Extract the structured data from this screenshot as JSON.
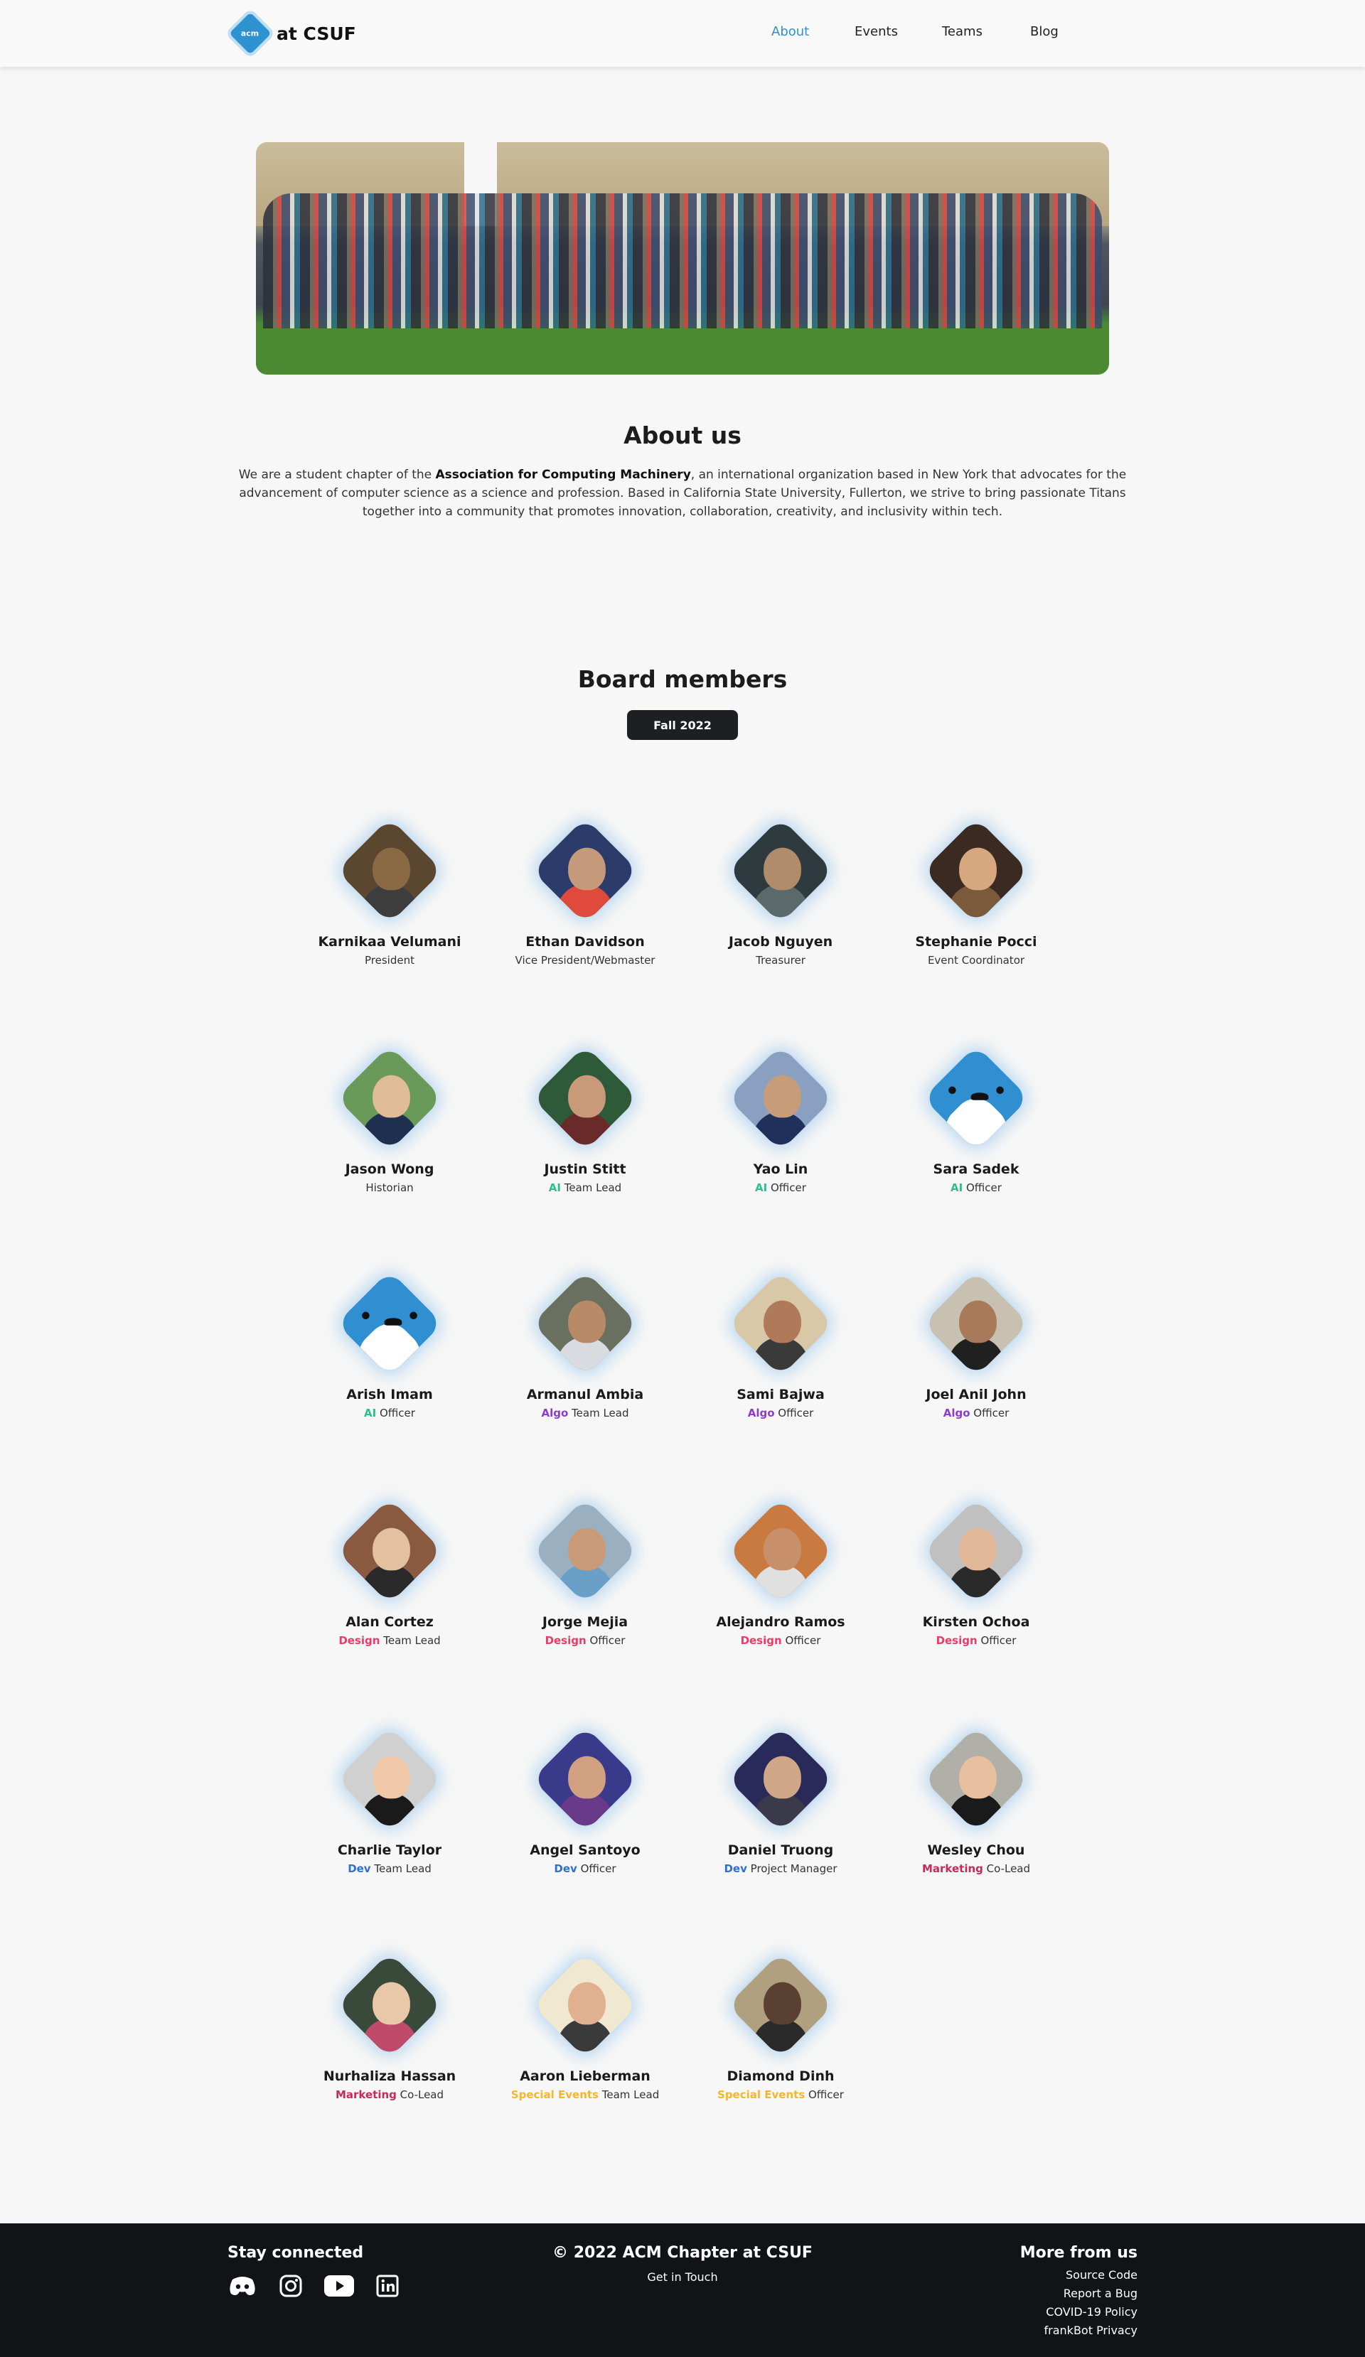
{
  "header": {
    "brand_logo_text": "acm",
    "brand_text": "at CSUF",
    "nav": [
      {
        "label": "About",
        "active": true
      },
      {
        "label": "Events",
        "active": false
      },
      {
        "label": "Teams",
        "active": false
      },
      {
        "label": "Blog",
        "active": false
      }
    ]
  },
  "about": {
    "title": "About us",
    "text_before": "We are a student chapter of the ",
    "text_bold": "Association for Computing Machinery",
    "text_after": ", an international organization based in New York that advocates for the advancement of computer science as a science and profession. Based in California State University, Fullerton, we strive to bring passionate Titans together into a community that promotes innovation, collaboration, creativity, and inclusivity within tech."
  },
  "board": {
    "title": "Board members",
    "term_button": "Fall 2022",
    "members": [
      {
        "name": "Karnikaa Velumani",
        "team": "",
        "role": "President"
      },
      {
        "name": "Ethan Davidson",
        "team": "",
        "role": "Vice President/Webmaster"
      },
      {
        "name": "Jacob Nguyen",
        "team": "",
        "role": "Treasurer"
      },
      {
        "name": "Stephanie Pocci",
        "team": "",
        "role": "Event Coordinator"
      },
      {
        "name": "Jason Wong",
        "team": "",
        "role": "Historian"
      },
      {
        "name": "Justin Stitt",
        "team": "AI",
        "role": " Team Lead"
      },
      {
        "name": "Yao Lin",
        "team": "AI",
        "role": " Officer"
      },
      {
        "name": "Sara Sadek",
        "team": "AI",
        "role": " Officer"
      },
      {
        "name": "Arish Imam",
        "team": "AI",
        "role": " Officer"
      },
      {
        "name": "Armanul Ambia",
        "team": "Algo",
        "role": " Team Lead"
      },
      {
        "name": "Sami Bajwa",
        "team": "Algo",
        "role": " Officer"
      },
      {
        "name": "Joel Anil John",
        "team": "Algo",
        "role": " Officer"
      },
      {
        "name": "Alan Cortez",
        "team": "Design",
        "role": " Team Lead"
      },
      {
        "name": "Jorge Mejia",
        "team": "Design",
        "role": " Officer"
      },
      {
        "name": "Alejandro Ramos",
        "team": "Design",
        "role": " Officer"
      },
      {
        "name": "Kirsten Ochoa",
        "team": "Design",
        "role": " Officer"
      },
      {
        "name": "Charlie Taylor",
        "team": "Dev",
        "role": " Team Lead"
      },
      {
        "name": "Angel Santoyo",
        "team": "Dev",
        "role": " Officer"
      },
      {
        "name": "Daniel Truong",
        "team": "Dev",
        "role": " Project Manager"
      },
      {
        "name": "Wesley Chou",
        "team": "Marketing",
        "role": " Co-Lead"
      },
      {
        "name": "Nurhaliza Hassan",
        "team": "Marketing",
        "role": " Co-Lead"
      },
      {
        "name": "Aaron Lieberman",
        "team": "Special Events",
        "role": " Team Lead"
      },
      {
        "name": "Diamond Dinh",
        "team": "Special Events",
        "role": " Officer"
      }
    ]
  },
  "colors": {
    "accent": "#2e92d0",
    "ai": "#2fbf8c",
    "algo": "#8e3bd1",
    "design": "#ec3b66",
    "dev": "#2e6fd0",
    "marketing": "#c62a5a",
    "special_events": "#f2b82b"
  },
  "footer": {
    "left_title": "Stay connected",
    "socials": [
      "discord-icon",
      "instagram-icon",
      "youtube-icon",
      "linkedin-icon"
    ],
    "center_title": "© 2022 ACM Chapter at CSUF",
    "center_link": "Get in Touch",
    "right_title": "More from us",
    "right_links": [
      "Source Code",
      "Report a Bug",
      "COVID-19 Policy",
      "frankBot Privacy"
    ]
  }
}
